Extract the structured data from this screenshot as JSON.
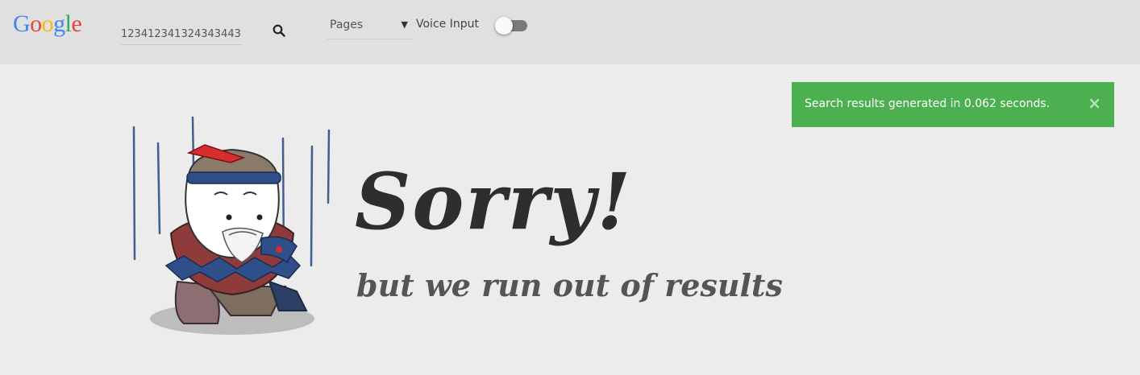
{
  "header": {
    "logo_letters": [
      "G",
      "o",
      "o",
      "g",
      "l",
      "e"
    ],
    "search": {
      "value": "123412341324343443",
      "icon": "search-icon"
    },
    "type_select": {
      "selected": "Pages",
      "arrow": "▼"
    },
    "voice_input": {
      "label": "Voice Input",
      "enabled": false
    }
  },
  "notification": {
    "message": "Search results generated in 0.062 seconds.",
    "close": "×",
    "color": "#4caf50"
  },
  "empty_state": {
    "title": "Sorry!",
    "subtitle": "but we run out of results",
    "illustration": "sad-character-illustration"
  }
}
